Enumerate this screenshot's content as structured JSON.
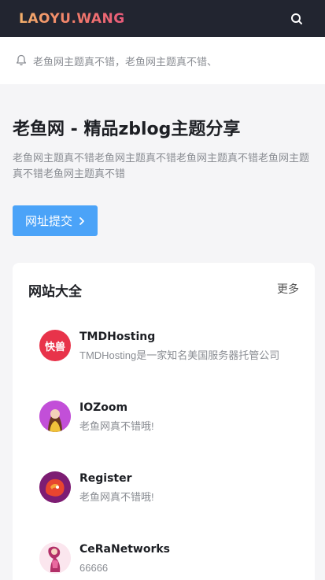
{
  "header": {
    "logo": "LAOYU.WANG",
    "search_icon": "search-icon"
  },
  "notice": {
    "icon": "bell-icon",
    "text": "老鱼网主题真不错，老鱼网主题真不错、"
  },
  "hero": {
    "title": "老鱼网 - 精品zblog主题分享",
    "description": "老鱼网主题真不错老鱼网主题真不错老鱼网主题真不错老鱼网主题真不错老鱼网主题真不错",
    "submit_label": "网址提交",
    "submit_icon": "chevron-right-icon",
    "accent": "#4ba3f8"
  },
  "sites_card": {
    "title": "网站大全",
    "more_label": "更多",
    "items": [
      {
        "name": "TMDHosting",
        "desc": "TMDHosting是一家知名美国服务器托管公司",
        "avatar_text": "快兽",
        "avatar_color": "#e8334a",
        "icon": "tmdhosting-logo-icon"
      },
      {
        "name": "IOZoom",
        "desc": "老鱼网真不错哦!",
        "avatar_color": "#b43bd1",
        "icon": "iozoom-avatar-icon"
      },
      {
        "name": "Register",
        "desc": "老鱼网真不错哦!",
        "avatar_color": "#8a1f7a",
        "icon": "register-avatar-icon"
      },
      {
        "name": "CeRaNetworks",
        "desc": "66666",
        "avatar_color": "#f3c7d8",
        "icon": "ceranetworks-avatar-icon"
      }
    ]
  }
}
